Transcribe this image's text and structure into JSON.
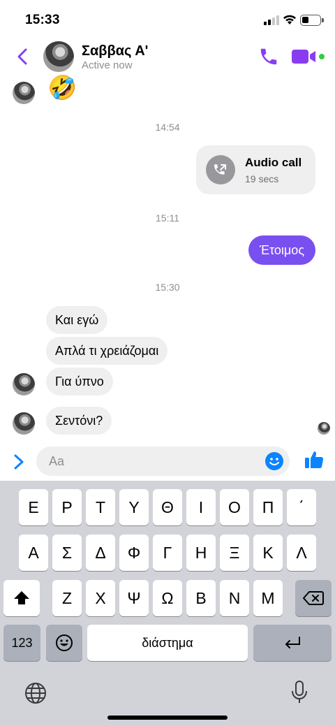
{
  "status_bar": {
    "time": "15:33"
  },
  "header": {
    "name": "Σαββας Α'",
    "status": "Active now"
  },
  "messages": {
    "emoji": "🤣",
    "time_1": "14:54",
    "call": {
      "title": "Audio call",
      "duration": "19 secs"
    },
    "time_2": "15:11",
    "outgoing": "Έτοιμος",
    "time_3": "15:30",
    "incoming": [
      "Και εγώ",
      "Απλά τι χρειάζομαι",
      "Για ύπνο",
      "Σεντόνι?"
    ]
  },
  "composer": {
    "placeholder": "Aa"
  },
  "keyboard": {
    "row1": [
      "Ε",
      "Ρ",
      "Τ",
      "Υ",
      "Θ",
      "Ι",
      "Ο",
      "Π",
      "΄"
    ],
    "row2": [
      "Α",
      "Σ",
      "Δ",
      "Φ",
      "Γ",
      "Η",
      "Ξ",
      "Κ",
      "Λ"
    ],
    "row3": [
      "Ζ",
      "Χ",
      "Ψ",
      "Ω",
      "Β",
      "Ν",
      "Μ"
    ],
    "numbers": "123",
    "space": "διάστημα"
  },
  "colors": {
    "accent": "#7a4ff0",
    "online": "#31cc46",
    "bubble_in": "#efeff0",
    "messenger_blue": "#0a84ff"
  },
  "icons": [
    "back-arrow-icon",
    "phone-icon",
    "video-camera-icon",
    "audio-call-icon",
    "chevron-right-icon",
    "smiley-icon",
    "thumbs-up-icon",
    "shift-icon",
    "backspace-icon",
    "emoji-keyboard-icon",
    "return-icon",
    "globe-icon",
    "microphone-icon"
  ]
}
